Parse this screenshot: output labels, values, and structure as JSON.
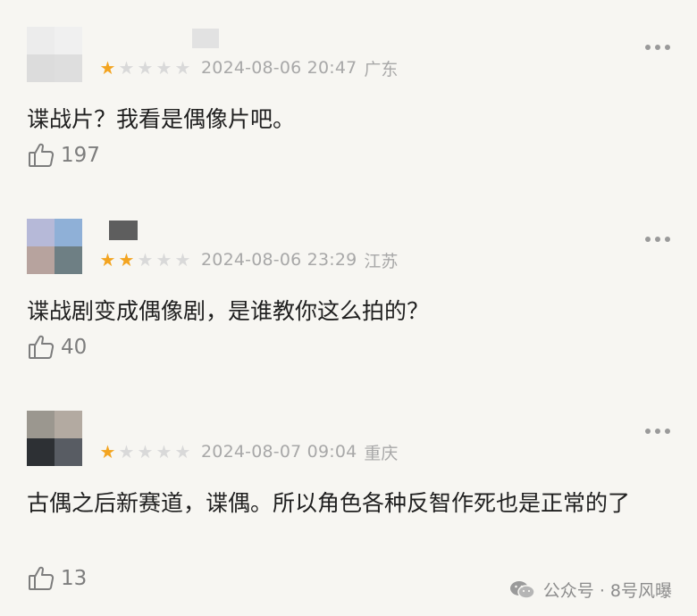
{
  "comments": [
    {
      "rating": 1,
      "rating_stars": [
        "★",
        "★",
        "★",
        "★",
        "★"
      ],
      "timestamp": "2024-08-06 20:47",
      "location": "广东",
      "text": "谍战片？我看是偶像片吧。",
      "likes": "197"
    },
    {
      "rating": 2,
      "rating_stars": [
        "★",
        "★",
        "★",
        "★",
        "★"
      ],
      "timestamp": "2024-08-06 23:29",
      "location": "江苏",
      "text": "谍战剧变成偶像剧，是谁教你这么拍的？",
      "likes": "40"
    },
    {
      "rating": 1,
      "rating_stars": [
        "★",
        "★",
        "★",
        "★",
        "★"
      ],
      "timestamp": "2024-08-07 09:04",
      "location": "重庆",
      "text": "古偶之后新赛道，谍偶。所以角色各种反智作死也是正常的了",
      "likes": "13"
    }
  ],
  "icons": {
    "like": "thumbs-up-icon",
    "more": "more-dots-icon",
    "wechat": "wechat-icon"
  },
  "colors": {
    "star_on": "#f3a420",
    "star_off": "#d9d9d9"
  },
  "watermark": {
    "text": "公众号 · 8号风曝"
  }
}
